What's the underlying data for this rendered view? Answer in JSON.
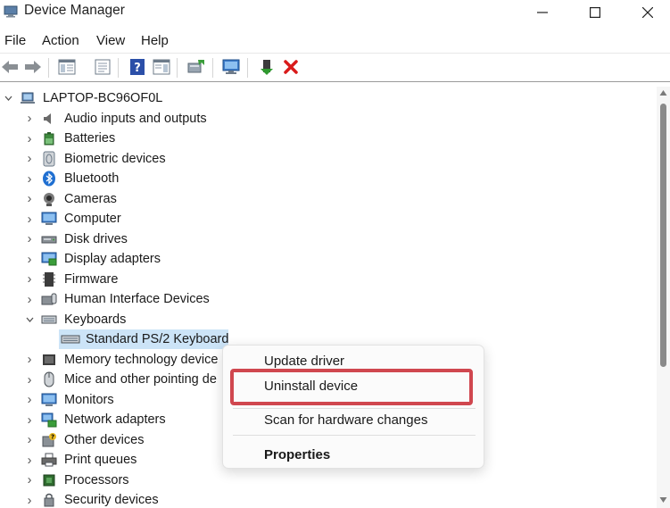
{
  "window": {
    "title": "Device Manager",
    "minimize_icon": "minimize-icon",
    "maximize_icon": "maximize-icon",
    "close_icon": "close-icon"
  },
  "menu": {
    "file": "File",
    "action": "Action",
    "view": "View",
    "help": "Help"
  },
  "toolbar": {
    "buttons": [
      "back-arrow-icon",
      "forward-arrow-icon",
      "show-hide-console-tree-icon",
      "properties-icon",
      "help-icon",
      "action-pane-icon",
      "update-driver-icon",
      "scan-hardware-icon",
      "enable-device-icon",
      "uninstall-icon"
    ]
  },
  "tree": {
    "root": "LAPTOP-BC96OF0L",
    "categories": [
      {
        "label": "Audio inputs and outputs",
        "icon": "speaker-icon",
        "expanded": false
      },
      {
        "label": "Batteries",
        "icon": "battery-icon",
        "expanded": false
      },
      {
        "label": "Biometric devices",
        "icon": "biometric-icon",
        "expanded": false
      },
      {
        "label": "Bluetooth",
        "icon": "bluetooth-icon",
        "expanded": false
      },
      {
        "label": "Cameras",
        "icon": "camera-icon",
        "expanded": false
      },
      {
        "label": "Computer",
        "icon": "computer-icon",
        "expanded": false
      },
      {
        "label": "Disk drives",
        "icon": "disk-drive-icon",
        "expanded": false
      },
      {
        "label": "Display adapters",
        "icon": "display-adapter-icon",
        "expanded": false
      },
      {
        "label": "Firmware",
        "icon": "firmware-icon",
        "expanded": false
      },
      {
        "label": "Human Interface Devices",
        "icon": "hid-icon",
        "expanded": false
      },
      {
        "label": "Keyboards",
        "icon": "keyboard-icon",
        "expanded": true
      },
      {
        "label": "Memory technology device",
        "icon": "memory-icon",
        "expanded": false
      },
      {
        "label": "Mice and other pointing de",
        "icon": "mouse-icon",
        "expanded": false
      },
      {
        "label": "Monitors",
        "icon": "monitor-icon",
        "expanded": false
      },
      {
        "label": "Network adapters",
        "icon": "network-adapter-icon",
        "expanded": false
      },
      {
        "label": "Other devices",
        "icon": "other-devices-icon",
        "expanded": false
      },
      {
        "label": "Print queues",
        "icon": "printer-icon",
        "expanded": false
      },
      {
        "label": "Processors",
        "icon": "processor-icon",
        "expanded": false
      },
      {
        "label": "Security devices",
        "icon": "security-icon",
        "expanded": false
      }
    ],
    "keyboard_child": "Standard PS/2 Keyboard"
  },
  "context_menu": {
    "update_driver": "Update driver",
    "uninstall_device": "Uninstall device",
    "scan_hardware": "Scan for hardware changes",
    "properties": "Properties"
  },
  "colors": {
    "selection": "#cce4f7",
    "highlight_box": "#d0474f"
  }
}
